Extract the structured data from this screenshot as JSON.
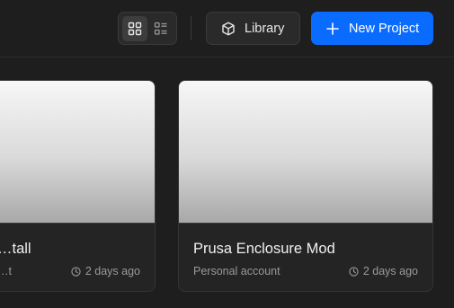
{
  "toolbar": {
    "view_toggle": {
      "active": "grid",
      "grid_icon": "grid-view-icon",
      "list_icon": "list-view-icon"
    },
    "library_button": {
      "label": "Library",
      "icon": "cube-icon"
    },
    "new_project_button": {
      "label": "New Project",
      "icon": "plus-icon",
      "color": "#0a6cff"
    }
  },
  "projects": [
    {
      "title": "…tall",
      "subtitle": "…t",
      "time": "2 days ago",
      "time_icon": "clock-icon"
    },
    {
      "title": "Prusa Enclosure Mod",
      "subtitle": "Personal account",
      "time": "2 days ago",
      "time_icon": "clock-icon"
    }
  ]
}
